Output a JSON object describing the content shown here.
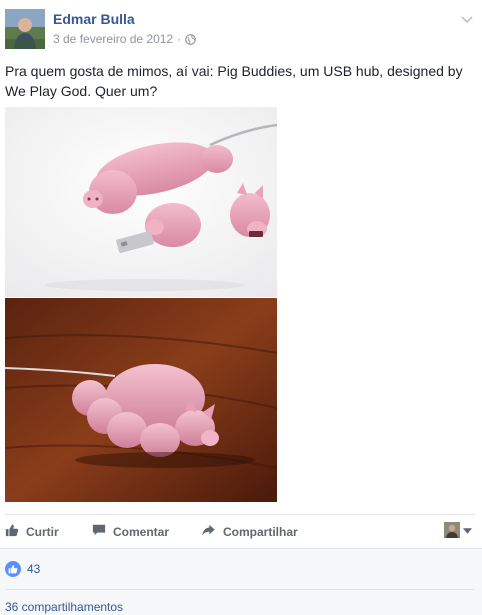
{
  "post": {
    "author": "Edmar Bulla",
    "date": "3 de fevereiro de 2012",
    "separator": "·",
    "privacy_icon": "globe-icon",
    "menu_icon": "chevron-down-icon",
    "text": "Pra quem gosta de mimos, aí vai: Pig Buddies, um USB hub, designed by We Play God. Quer um?",
    "photos": [
      {
        "icon": "photo-pig-usb-hub-white-background"
      },
      {
        "icon": "photo-pig-usb-hub-wood-table"
      }
    ]
  },
  "actions": {
    "like_label": "Curtir",
    "like_icon": "thumbs-up-icon",
    "comment_label": "Comentar",
    "comment_icon": "comment-icon",
    "share_label": "Compartilhar",
    "share_icon": "share-arrow-icon",
    "profile_menu_icon": "caret-down-icon"
  },
  "footer": {
    "reaction_count": "43",
    "reaction_icon": "like-reaction-icon",
    "shares_text": "36 compartilhamentos"
  },
  "colors": {
    "link_blue": "#365899",
    "meta_gray": "#90949c",
    "action_gray": "#606770",
    "like_blue": "#5890ff",
    "footer_bg": "#f6f7f9",
    "pig_pink": "#e8a3b9"
  }
}
